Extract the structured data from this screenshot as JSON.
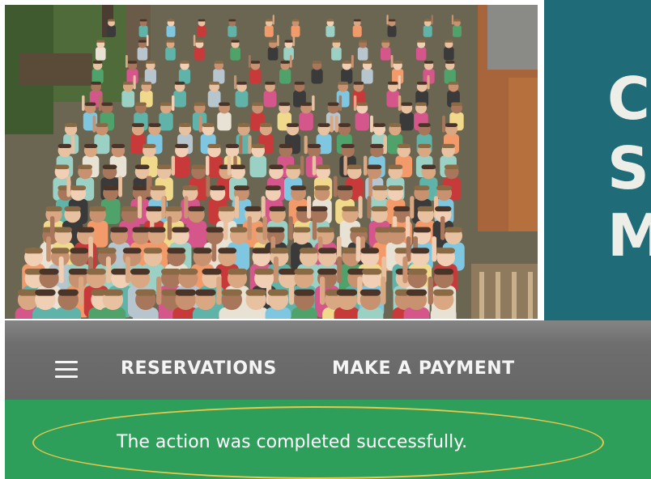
{
  "hero": {
    "photo_alt": "camp-group-photo",
    "brand_letters": [
      "C",
      "S",
      "M"
    ],
    "brand_color": "#1f6b78"
  },
  "nav": {
    "menu_icon": "hamburger-menu-icon",
    "links": [
      {
        "label": "RESERVATIONS"
      },
      {
        "label": "MAKE A PAYMENT"
      }
    ],
    "background": "#6e6e6e"
  },
  "alert": {
    "message": "The action was completed successfully.",
    "background": "#2e9e5b",
    "highlight_color": "#e6c84a"
  }
}
